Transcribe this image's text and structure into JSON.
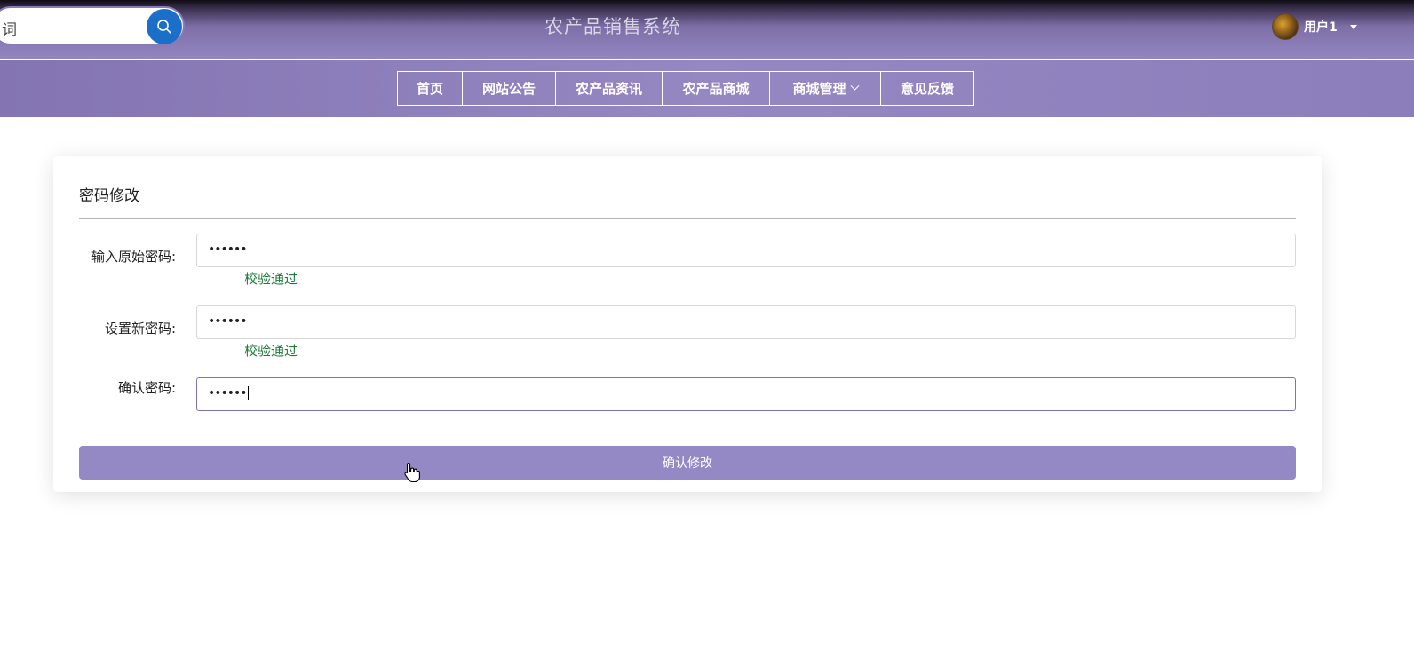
{
  "header": {
    "search": {
      "value": "词"
    },
    "site_title": "农产品销售系统",
    "user": {
      "name": "用户1"
    }
  },
  "nav": {
    "items": [
      {
        "label": "首页"
      },
      {
        "label": "网站公告"
      },
      {
        "label": "农产品资讯"
      },
      {
        "label": "农产品商城"
      },
      {
        "label": "商城管理",
        "has_dropdown": true
      },
      {
        "label": "意见反馈"
      }
    ]
  },
  "form": {
    "title": "密码修改",
    "fields": [
      {
        "label": "输入原始密码:",
        "value": "••••••",
        "status": "校验通过"
      },
      {
        "label": "设置新密码:",
        "value": "••••••",
        "status": "校验通过"
      },
      {
        "label": "确认密码:",
        "value": "••••••"
      }
    ],
    "submit_label": "确认修改"
  },
  "colors": {
    "header": "#9385c0",
    "nav": "#8e80bc",
    "submit": "#9589c5",
    "valid": "#1f7a3a",
    "search_button": "#1c6fc9"
  }
}
